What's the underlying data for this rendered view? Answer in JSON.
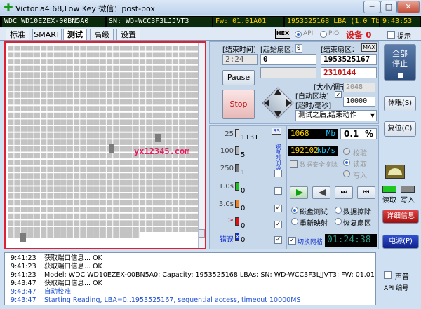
{
  "window": {
    "title": "Victoria4.68,Low Key 微信：post-box",
    "minimize": "─",
    "maximize": "□",
    "close": "✕"
  },
  "infobar": {
    "model": "WDC WD10EZEX-00BN5A0",
    "serial": "SN: WD-WCC3F3LJJVT3",
    "firmware": "Fw: 01.01A01",
    "lba": "1953525168 LBA (1.0 Tb)",
    "clock": "9:43:53"
  },
  "tabs": [
    "标准",
    "SMART",
    "测试",
    "高级",
    "设置"
  ],
  "active_tab": "测试",
  "options": {
    "hex_label": "HEX",
    "api_label": "API",
    "pio_label": "PIO",
    "device_label": "设备 0",
    "hint_label": "提示"
  },
  "test": {
    "end_time_label": "[结束时间]",
    "end_time_value": "2:24",
    "start_sector_label": "[起始扇区：",
    "start_sector_value": "0",
    "start_sector_input": "0",
    "end_sector_label": "[结束扇区：",
    "end_sector_max": "MAX",
    "end_sector_value": "1953525167",
    "current_lba": "2310144",
    "pause_label": "Pause",
    "stop_label": "Stop",
    "block_size_label": "[大小/调节]",
    "auto_block_label": "[自动区块]",
    "timeout_label": "[超时/毫秒]",
    "block_size_value": "2048",
    "timeout_value": "10000",
    "after_test_action": "测试之后,结束动作"
  },
  "stats": {
    "header": "RS",
    "rows": [
      {
        "threshold": "25",
        "count": "1131",
        "color": "#d9d9d9"
      },
      {
        "threshold": "100",
        "count": "5",
        "color": "#b3b3b3"
      },
      {
        "threshold": "250",
        "count": "1",
        "color": "#7a7a7a"
      },
      {
        "threshold": "1.0s",
        "count": "0",
        "color": "#20c020"
      },
      {
        "threshold": "3.0s",
        "count": "0",
        "color": "#f08020"
      },
      {
        "threshold": ">",
        "count": "0",
        "color": "#e01010"
      },
      {
        "threshold": "错误",
        "count": "0",
        "color": "#1030d0"
      }
    ],
    "side_label": "读写时间段"
  },
  "perf": {
    "mb_value": "1068",
    "mb_unit": "Mb",
    "percent_value": "0.1",
    "percent_unit": "%",
    "speed_value": "192102",
    "speed_unit": "kb/s",
    "verify_label": "校验",
    "read_label": "读取",
    "write_label": "写入",
    "ddd_label": "数据安全擦除",
    "mode_scan": "磁盘测试",
    "mode_erase": "数据擦除",
    "mode_remap": "重新映射",
    "mode_restore": "恢复扇区",
    "grid_label": "切换网格",
    "elapsed": "01:24:38"
  },
  "sidebar": {
    "stop_all": "全部停止",
    "sleep": "休眠(S)",
    "reset": "复位(C)",
    "read": "读取",
    "write": "写入",
    "details": "详细信息",
    "power": "电源(P)",
    "sound": "声音",
    "api_number": "API 编号"
  },
  "log": [
    {
      "time": "9:41:23",
      "text": "获取端口信息... OK",
      "color": "#1a1a1a"
    },
    {
      "time": "9:41:23",
      "text": "获取端口信息... OK",
      "color": "#1a1a1a"
    },
    {
      "time": "9:41:23",
      "text": "Model: WDC WD10EZEX-00BN5A0; Capacity: 1953525168 LBAs; SN: WD-WCC3F3LJJVT3; FW: 01.01...",
      "color": "#1a1a1a"
    },
    {
      "time": "9:43:47",
      "text": "获取端口信息... OK",
      "color": "#1a1a1a"
    },
    {
      "time": "9:43:47",
      "text": "自动校准",
      "color": "#1e50d0"
    },
    {
      "time": "9:43:47",
      "text": "Starting Reading, LBA=0..1953525167, sequential access, timeout 10000MS",
      "color": "#1e50d0"
    }
  ],
  "watermark": "yx12345.com"
}
